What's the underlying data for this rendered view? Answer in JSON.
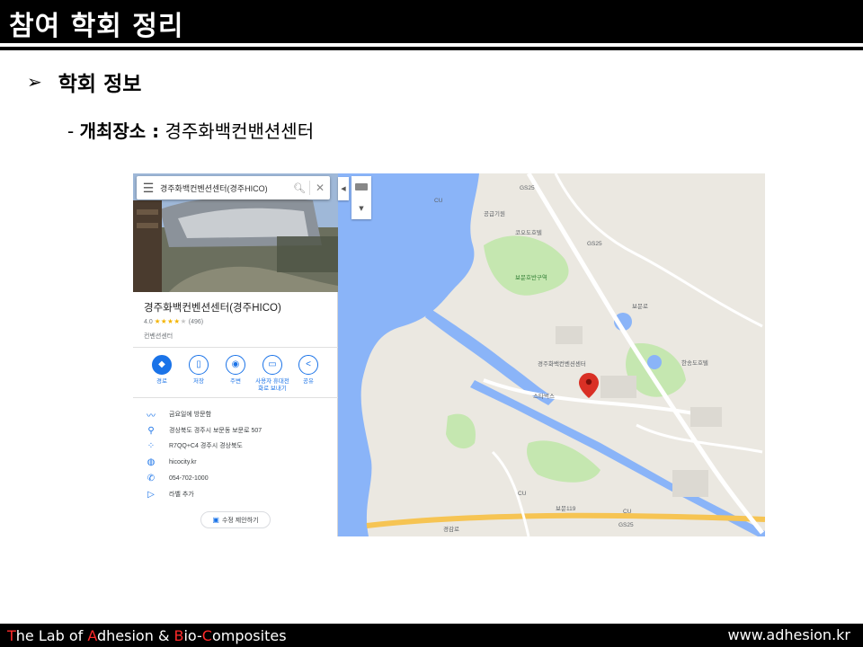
{
  "slide": {
    "title": "참여 학회 정리",
    "heading": "학회 정보",
    "detail_label": "개최장소 :",
    "detail_value": "경주화백컨밴션센터"
  },
  "map_panel": {
    "search_text": "경주화백컨벤션센터(경주HICO)",
    "place_name": "경주화백컨벤션센터(경주HICO)",
    "rating_value": "4.0",
    "rating_stars": 4,
    "review_count": "(496)",
    "place_type": "컨벤션센터",
    "actions": [
      {
        "label": "경로",
        "icon": "directions-icon"
      },
      {
        "label": "저장",
        "icon": "bookmark-icon"
      },
      {
        "label": "주변",
        "icon": "nearby-icon"
      },
      {
        "label": "사용자 휴대전\n화로 보내기",
        "icon": "send-to-phone-icon"
      },
      {
        "label": "공유",
        "icon": "share-icon"
      }
    ],
    "info_rows": [
      {
        "icon": "popular-times-icon",
        "text": "금요일에 방문함"
      },
      {
        "icon": "location-pin-icon",
        "text": "경상북도 경주시 보문동 보문로 507"
      },
      {
        "icon": "plus-code-icon",
        "text": "R7QQ+C4 경주시 경상북도"
      },
      {
        "icon": "globe-icon",
        "text": "hicocity.kr"
      },
      {
        "icon": "phone-icon",
        "text": "054-702-1000"
      },
      {
        "icon": "label-icon",
        "text": "라벨 추가"
      }
    ],
    "suggest_edit": "수정 제안하기"
  },
  "map_labels": {
    "cu1": "CU",
    "gs25_1": "GS25",
    "hotel1": "공급기원",
    "hotel2": "코오도호텔",
    "gs25_2": "GS25",
    "bomun_park": "보문호반구역",
    "bomun_road": "보문로",
    "red_pin": "경주화백컨벤션센터",
    "starbucks": "스타벅스",
    "hotel3": "한송도호텔",
    "gs25_3": "GS25",
    "cu2": "CU",
    "bomun119": "보문119",
    "kyeonggam": "경감로",
    "cu3": "CU"
  },
  "footer": {
    "lab_part1": "T",
    "lab_part2": "he Lab of ",
    "lab_part3": "A",
    "lab_part4": "dhesion & ",
    "lab_part5": "B",
    "lab_part6": "io-",
    "lab_part7": "C",
    "lab_part8": "omposites",
    "website": "www.adhesion.kr"
  },
  "colors": {
    "water": "#8ab4f8",
    "park": "#c5e7b0",
    "land": "#ebe8e1",
    "road_major": "#f6c453",
    "accent_blue": "#1a73e8",
    "pin_red": "#d93025",
    "footer_red": "#ff2a2a"
  }
}
